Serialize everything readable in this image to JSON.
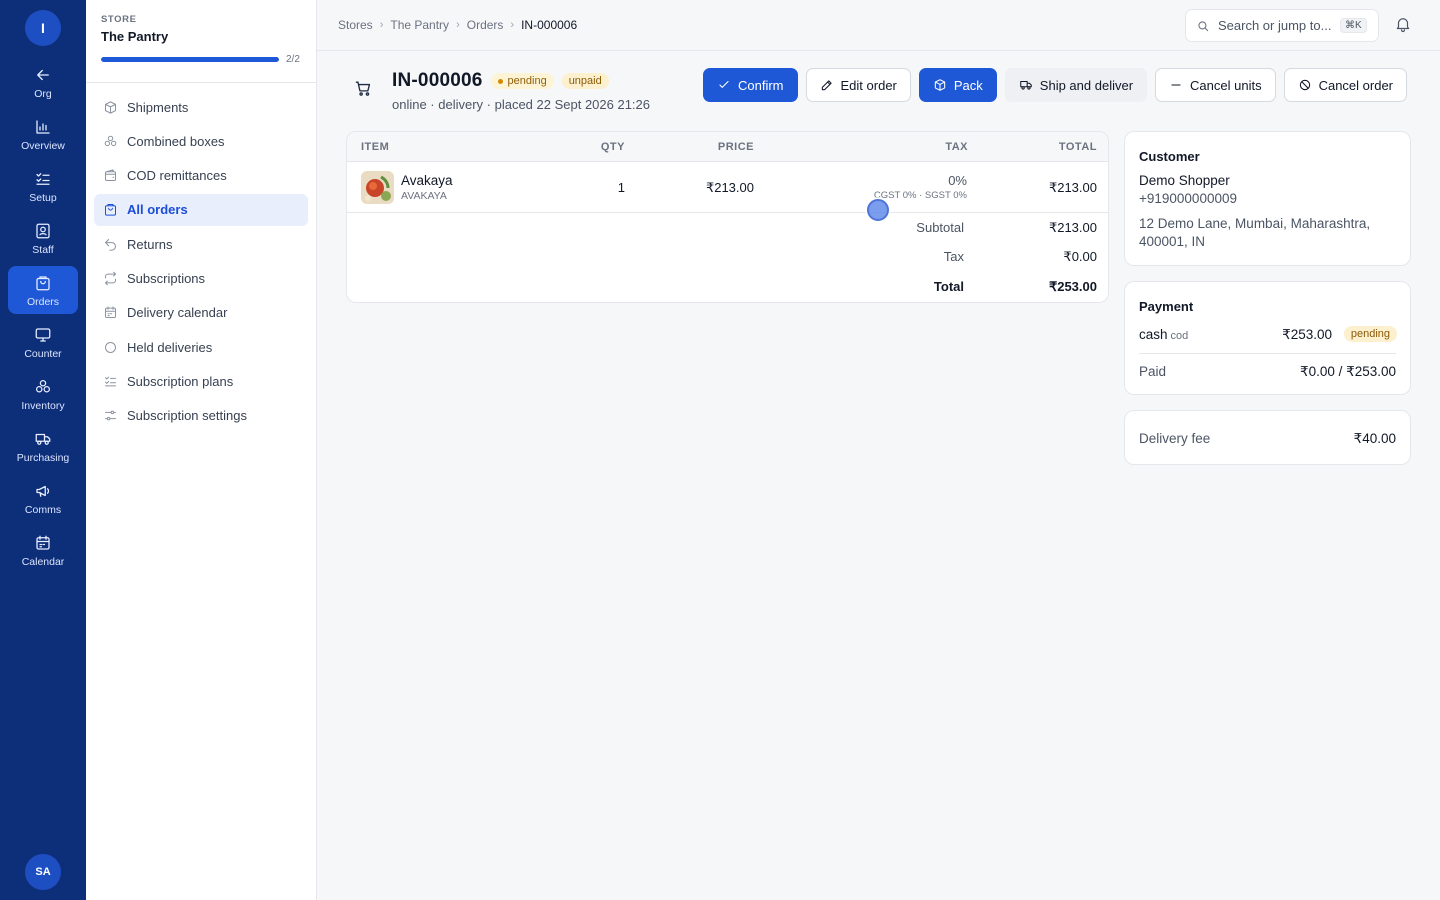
{
  "rail": {
    "logo": "I",
    "items": [
      {
        "label": "Org",
        "icon": "arrow-left-icon"
      },
      {
        "label": "Overview",
        "icon": "chart-bars-icon"
      },
      {
        "label": "Setup",
        "icon": "checklist-icon"
      },
      {
        "label": "Staff",
        "icon": "id-badge-icon"
      },
      {
        "label": "Orders",
        "icon": "shopping-bag-icon",
        "active": true
      },
      {
        "label": "Counter",
        "icon": "monitor-icon"
      },
      {
        "label": "Inventory",
        "icon": "boxes-icon"
      },
      {
        "label": "Purchasing",
        "icon": "truck-icon"
      },
      {
        "label": "Comms",
        "icon": "megaphone-icon"
      },
      {
        "label": "Calendar",
        "icon": "calendar-icon"
      }
    ],
    "avatar": "SA"
  },
  "sidebar": {
    "kicker": "STORE",
    "store_name": "The Pantry",
    "progress": {
      "value": 1.0,
      "label": "2/2"
    },
    "items": [
      {
        "label": "Shipments",
        "icon": "package-icon"
      },
      {
        "label": "Combined boxes",
        "icon": "boxes-icon"
      },
      {
        "label": "COD remittances",
        "icon": "wallet-icon"
      },
      {
        "label": "All orders",
        "icon": "shopping-bag-icon",
        "active": true
      },
      {
        "label": "Returns",
        "icon": "undo-icon"
      },
      {
        "label": "Subscriptions",
        "icon": "repeat-icon"
      },
      {
        "label": "Delivery calendar",
        "icon": "calendar-icon"
      },
      {
        "label": "Held deliveries",
        "icon": "circle-icon"
      },
      {
        "label": "Subscription plans",
        "icon": "list-check-icon"
      },
      {
        "label": "Subscription settings",
        "icon": "settings-sliders-icon"
      }
    ]
  },
  "topbar": {
    "breadcrumbs": [
      "Stores",
      "The Pantry",
      "Orders",
      "IN-000006"
    ],
    "search_placeholder": "Search or jump to...",
    "shortcut": "⌘K"
  },
  "order": {
    "id": "IN-000006",
    "status": "pending",
    "payment_status": "unpaid",
    "meta": "online · delivery · placed 22 Sept 2026 21:26",
    "actions": {
      "confirm": "Confirm",
      "edit": "Edit order",
      "pack": "Pack",
      "ship": "Ship and deliver",
      "cancel_units": "Cancel units",
      "cancel_order": "Cancel order"
    }
  },
  "items_table": {
    "headers": {
      "item": "ITEM",
      "qty": "QTY",
      "price": "PRICE",
      "tax": "TAX",
      "total": "TOTAL"
    },
    "rows": [
      {
        "name": "Avakaya",
        "sku": "AVAKAYA",
        "qty": "1",
        "price": "₹213.00",
        "tax": "0%",
        "tax_detail": "CGST 0% · SGST 0%",
        "total": "₹213.00"
      }
    ],
    "summary": {
      "subtotal_label": "Subtotal",
      "subtotal": "₹213.00",
      "tax_label": "Tax",
      "tax": "₹0.00",
      "total_label": "Total",
      "total": "₹253.00"
    }
  },
  "customer": {
    "title": "Customer",
    "name": "Demo Shopper",
    "phone": "+919000000009",
    "address": "12 Demo Lane, Mumbai, Maharashtra, 400001, IN"
  },
  "payment": {
    "title": "Payment",
    "method": "cash",
    "method_sub": "cod",
    "amount": "₹253.00",
    "status": "pending",
    "paid_label": "Paid",
    "paid_value": "₹0.00 / ₹253.00"
  },
  "delivery": {
    "fee_label": "Delivery fee",
    "fee_value": "₹40.00"
  },
  "colors": {
    "rail": "#0d2f7a",
    "accent": "#1f58d6",
    "pending_bg": "#fdf3d5"
  }
}
